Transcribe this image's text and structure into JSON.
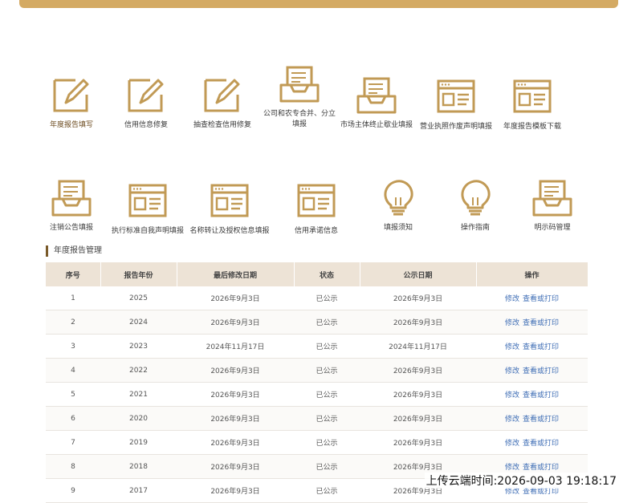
{
  "colors": {
    "gold": "#c19a55",
    "header_bg": "#ede3d6",
    "link": "#3e6db5"
  },
  "tiles": [
    {
      "label": "年度报告填写",
      "icon": "edit-icon"
    },
    {
      "label": "信用信息修复",
      "icon": "edit-icon"
    },
    {
      "label": "抽查检查信用修复",
      "icon": "edit-icon"
    },
    {
      "label": "公司和农专合并、分立填报",
      "icon": "inbox-icon"
    },
    {
      "label": "市场主体终止歇业填报",
      "icon": "inbox-icon"
    },
    {
      "label": "营业执照作废声明填报",
      "icon": "browser-icon"
    },
    {
      "label": "年度报告模板下载",
      "icon": "browser-icon"
    },
    {
      "label": "注销公告填报",
      "icon": "inbox-icon"
    },
    {
      "label": "执行标准自我声明填报",
      "icon": "browser-icon"
    },
    {
      "label": "名称转让及授权信息填报",
      "icon": "browser-icon"
    },
    {
      "label": "信用承诺信息",
      "icon": "browser-icon"
    },
    {
      "label": "填报须知",
      "icon": "lightbulb-icon"
    },
    {
      "label": "操作指南",
      "icon": "lightbulb-icon"
    },
    {
      "label": "明示码管理",
      "icon": "inbox-icon"
    }
  ],
  "section_title": "年度报告管理",
  "table": {
    "headers": [
      "序号",
      "报告年份",
      "最后修改日期",
      "状态",
      "公示日期",
      "操作"
    ],
    "rows": [
      [
        "1",
        "2025",
        "2026年9月3日",
        "已公示",
        "2026年9月3日"
      ],
      [
        "2",
        "2024",
        "2026年9月3日",
        "已公示",
        "2026年9月3日"
      ],
      [
        "3",
        "2023",
        "2024年11月17日",
        "已公示",
        "2024年11月17日"
      ],
      [
        "4",
        "2022",
        "2026年9月3日",
        "已公示",
        "2026年9月3日"
      ],
      [
        "5",
        "2021",
        "2026年9月3日",
        "已公示",
        "2026年9月3日"
      ],
      [
        "6",
        "2020",
        "2026年9月3日",
        "已公示",
        "2026年9月3日"
      ],
      [
        "7",
        "2019",
        "2026年9月3日",
        "已公示",
        "2026年9月3日"
      ],
      [
        "8",
        "2018",
        "2026年9月3日",
        "已公示",
        "2026年9月3日"
      ],
      [
        "9",
        "2017",
        "2026年9月3日",
        "已公示",
        "2026年9月3日"
      ]
    ],
    "op_edit": "修改",
    "op_view": "查看或打印"
  },
  "watermark": "上传云端时间:2026-09-03 19:18:17"
}
